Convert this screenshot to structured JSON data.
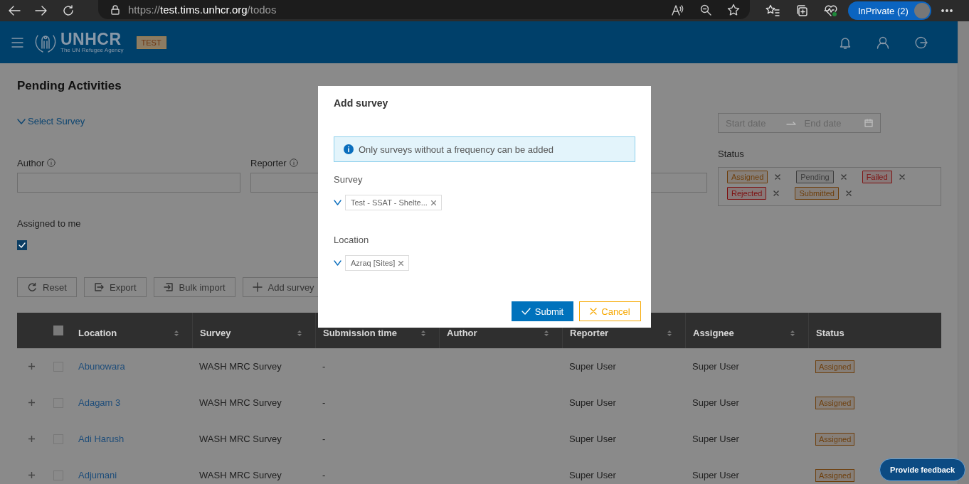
{
  "browser": {
    "url_scheme": "https://",
    "url_host": "test.tims.unhcr.org",
    "url_path": "/todos",
    "profile": "InPrivate (2)"
  },
  "header": {
    "logo": "UNHCR",
    "logo_tagline": "The UN Refugee Agency",
    "env_badge": "TEST"
  },
  "page": {
    "title": "Pending Activities",
    "survey_toggle": "Select Survey",
    "filters": [
      {
        "label": "Author"
      },
      {
        "label": "Reporter"
      }
    ],
    "assigned_to_me": {
      "label": "Assigned to me",
      "checked": true
    },
    "date_range": {
      "start_placeholder": "Start date",
      "end_placeholder": "End date"
    },
    "status_filter": {
      "label": "Status",
      "tags": [
        {
          "label": "Assigned",
          "color": "#6e3f0c"
        },
        {
          "label": "Pending",
          "color": "#3e3e3e"
        },
        {
          "label": "Failed",
          "color": "#7e1010"
        },
        {
          "label": "Rejected",
          "color": "#7e1010"
        },
        {
          "label": "Submitted",
          "color": "#6e3f0c"
        }
      ]
    },
    "actions": [
      {
        "label": "Reset",
        "kind": "reset"
      },
      {
        "label": "Export",
        "kind": "export"
      },
      {
        "label": "Bulk import",
        "kind": "import"
      },
      {
        "label": "Add survey",
        "kind": "add"
      }
    ]
  },
  "table": {
    "select_all_checked": false,
    "columns": [
      {
        "label": "Location",
        "sortable": true
      },
      {
        "label": "Survey",
        "sortable": true
      },
      {
        "label": "Submission time",
        "sortable": true
      },
      {
        "label": "Author",
        "sortable": true
      },
      {
        "label": "Reporter",
        "sortable": true
      },
      {
        "label": "Assignee",
        "sortable": true
      },
      {
        "label": "Status",
        "sortable": false
      }
    ],
    "rows": [
      {
        "checked": false,
        "location": "Abunowara",
        "survey": "WASH MRC Survey",
        "submission_time": "-",
        "reporter": "Super User",
        "assignee": "Super User",
        "status": "Assigned",
        "color": "#6e3f0c"
      },
      {
        "checked": false,
        "location": "Adagam 3",
        "survey": "WASH MRC Survey",
        "submission_time": "-",
        "reporter": "Super User",
        "assignee": "Super User",
        "status": "Assigned",
        "color": "#6e3f0c"
      },
      {
        "checked": false,
        "location": "Adi Harush",
        "survey": "WASH MRC Survey",
        "submission_time": "-",
        "reporter": "Super User",
        "assignee": "Super User",
        "status": "Assigned",
        "color": "#6e3f0c"
      },
      {
        "checked": false,
        "location": "Adjumani",
        "survey": "WASH MRC Survey",
        "submission_time": "-",
        "reporter": "Super User",
        "assignee": "Super User",
        "status": "Assigned",
        "color": "#6e3f0c"
      }
    ]
  },
  "dialog": {
    "title": "Add survey",
    "notice": "Only surveys without a frequency can be added",
    "fields": [
      {
        "label": "Survey",
        "value": "Test - SSAT - Shelte..."
      },
      {
        "label": "Location",
        "value": "Azraq [Sites]"
      }
    ],
    "submit": "Submit",
    "cancel": "Cancel"
  },
  "feedback_button": "Provide feedback"
}
